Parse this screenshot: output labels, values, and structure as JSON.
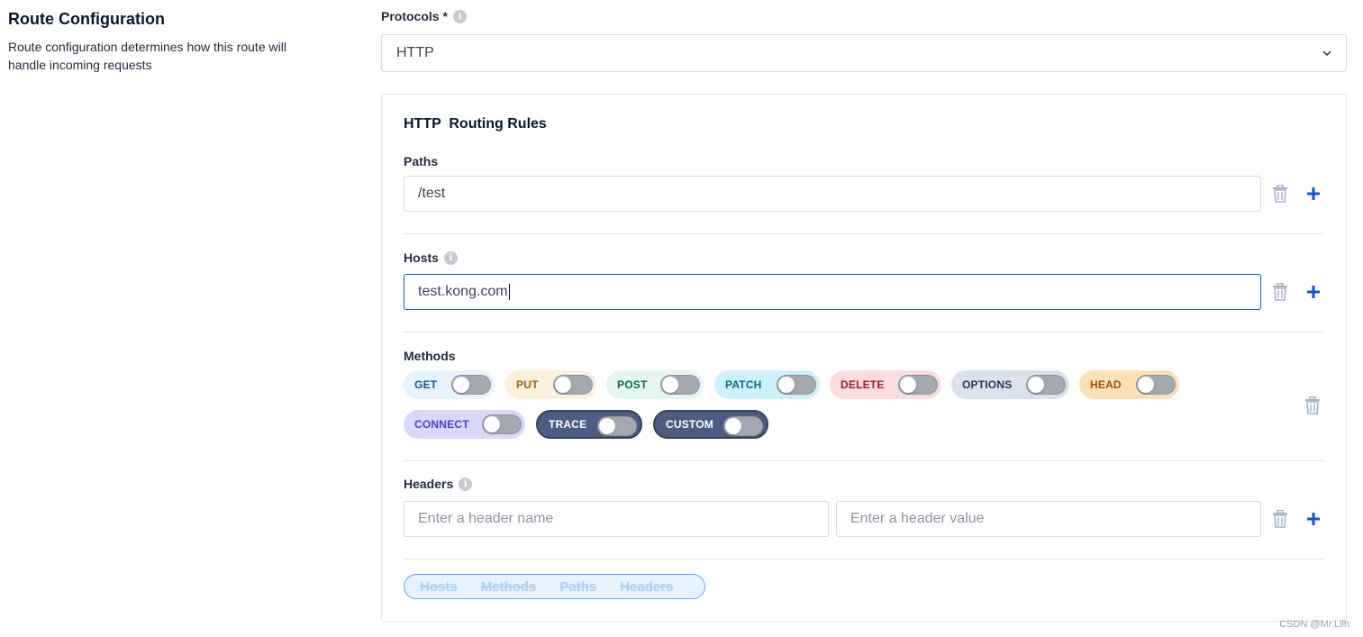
{
  "section": {
    "title": "Route Configuration",
    "description": "Route configuration determines how this route will handle incoming requests"
  },
  "protocols": {
    "label": "Protocols *",
    "value": "HTTP"
  },
  "card": {
    "title": "HTTP  Routing Rules",
    "paths": {
      "label": "Paths",
      "value": "/test"
    },
    "hosts": {
      "label": "Hosts",
      "value": "test.kong.com"
    },
    "methods": {
      "label": "Methods",
      "items": [
        {
          "label": "GET",
          "enabled": false,
          "bg": "#e7f3fd",
          "fg": "#0a5a9c"
        },
        {
          "label": "PUT",
          "enabled": false,
          "bg": "#fdf0df",
          "fg": "#a35a0a"
        },
        {
          "label": "POST",
          "enabled": false,
          "bg": "#e4f6ef",
          "fg": "#0a6a49"
        },
        {
          "label": "PATCH",
          "enabled": false,
          "bg": "#cdf1fa",
          "fg": "#0b6a84"
        },
        {
          "label": "DELETE",
          "enabled": false,
          "bg": "#fbdde0",
          "fg": "#9b1b2c"
        },
        {
          "label": "OPTIONS",
          "enabled": false,
          "bg": "#dbe2ee",
          "fg": "#263450"
        },
        {
          "label": "HEAD",
          "enabled": false,
          "bg": "#fde1b6",
          "fg": "#a34e0a"
        },
        {
          "label": "CONNECT",
          "enabled": false,
          "bg": "#d9d8fb",
          "fg": "#4b3ccc"
        },
        {
          "label": "TRACE",
          "enabled": false,
          "bg": "#4c5d80",
          "fg": "#ffffff"
        },
        {
          "label": "CUSTOM",
          "enabled": false,
          "bg": "#4c5d80",
          "fg": "#ffffff"
        }
      ]
    },
    "headers": {
      "label": "Headers",
      "name_placeholder": "Enter a header name",
      "value_placeholder": "Enter a header value"
    },
    "tabs": [
      "Hosts",
      "Methods",
      "Paths",
      "Headers"
    ]
  },
  "icons": {
    "info": "info-icon",
    "chevron": "chevron-down-icon",
    "trash": "trash-icon",
    "plus": "plus-icon"
  },
  "colors": {
    "accent": "#1155cb",
    "trash": "#a3b1c6"
  },
  "watermark": "CSDN @Mr.Lilh"
}
